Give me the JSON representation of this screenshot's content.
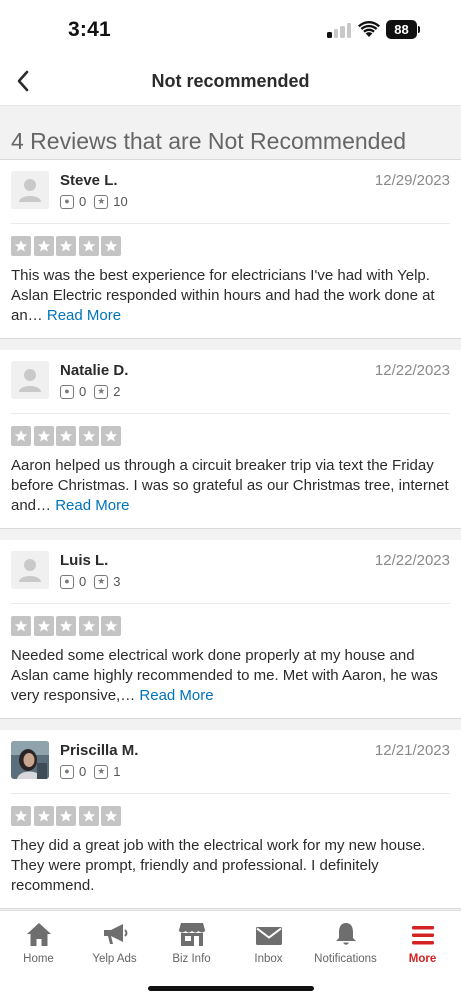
{
  "status_bar": {
    "time": "3:41",
    "battery": "88"
  },
  "nav": {
    "title": "Not recommended"
  },
  "section": {
    "heading": "4 Reviews that are Not Recommended"
  },
  "reviews": [
    {
      "name": "Steve L.",
      "date": "12/29/2023",
      "friends": "0",
      "reviews_count": "10",
      "rating": 5,
      "text": "This was the best experience for electricians I've had with Yelp. Aslan Electric responded within hours and had the work done at an…",
      "read_more": "Read More"
    },
    {
      "name": "Natalie D.",
      "date": "12/22/2023",
      "friends": "0",
      "reviews_count": "2",
      "rating": 5,
      "text": "Aaron helped us through a circuit breaker trip via text the Friday before Christmas.  I was so grateful as our Christmas tree, internet and…",
      "read_more": "Read More"
    },
    {
      "name": "Luis L.",
      "date": "12/22/2023",
      "friends": "0",
      "reviews_count": "3",
      "rating": 5,
      "text": "Needed some electrical work done properly at my house and Aslan came highly recommended to me. Met with Aaron, he was very responsive,…",
      "read_more": "Read More"
    },
    {
      "name": "Priscilla M.",
      "date": "12/21/2023",
      "friends": "0",
      "reviews_count": "1",
      "rating": 5,
      "text": "They did a great job with the electrical work for my new house. They were prompt, friendly and professional. I definitely recommend.",
      "read_more": ""
    }
  ],
  "tabs": [
    {
      "label": "Home",
      "icon": "home-icon"
    },
    {
      "label": "Yelp Ads",
      "icon": "megaphone-icon"
    },
    {
      "label": "Biz Info",
      "icon": "storefront-icon"
    },
    {
      "label": "Inbox",
      "icon": "envelope-icon"
    },
    {
      "label": "Notifications",
      "icon": "bell-icon"
    },
    {
      "label": "More",
      "icon": "menu-icon",
      "active": true
    }
  ],
  "colors": {
    "accent": "#d32323",
    "link": "#0073bb",
    "star_inactive": "#c4c4c4"
  }
}
